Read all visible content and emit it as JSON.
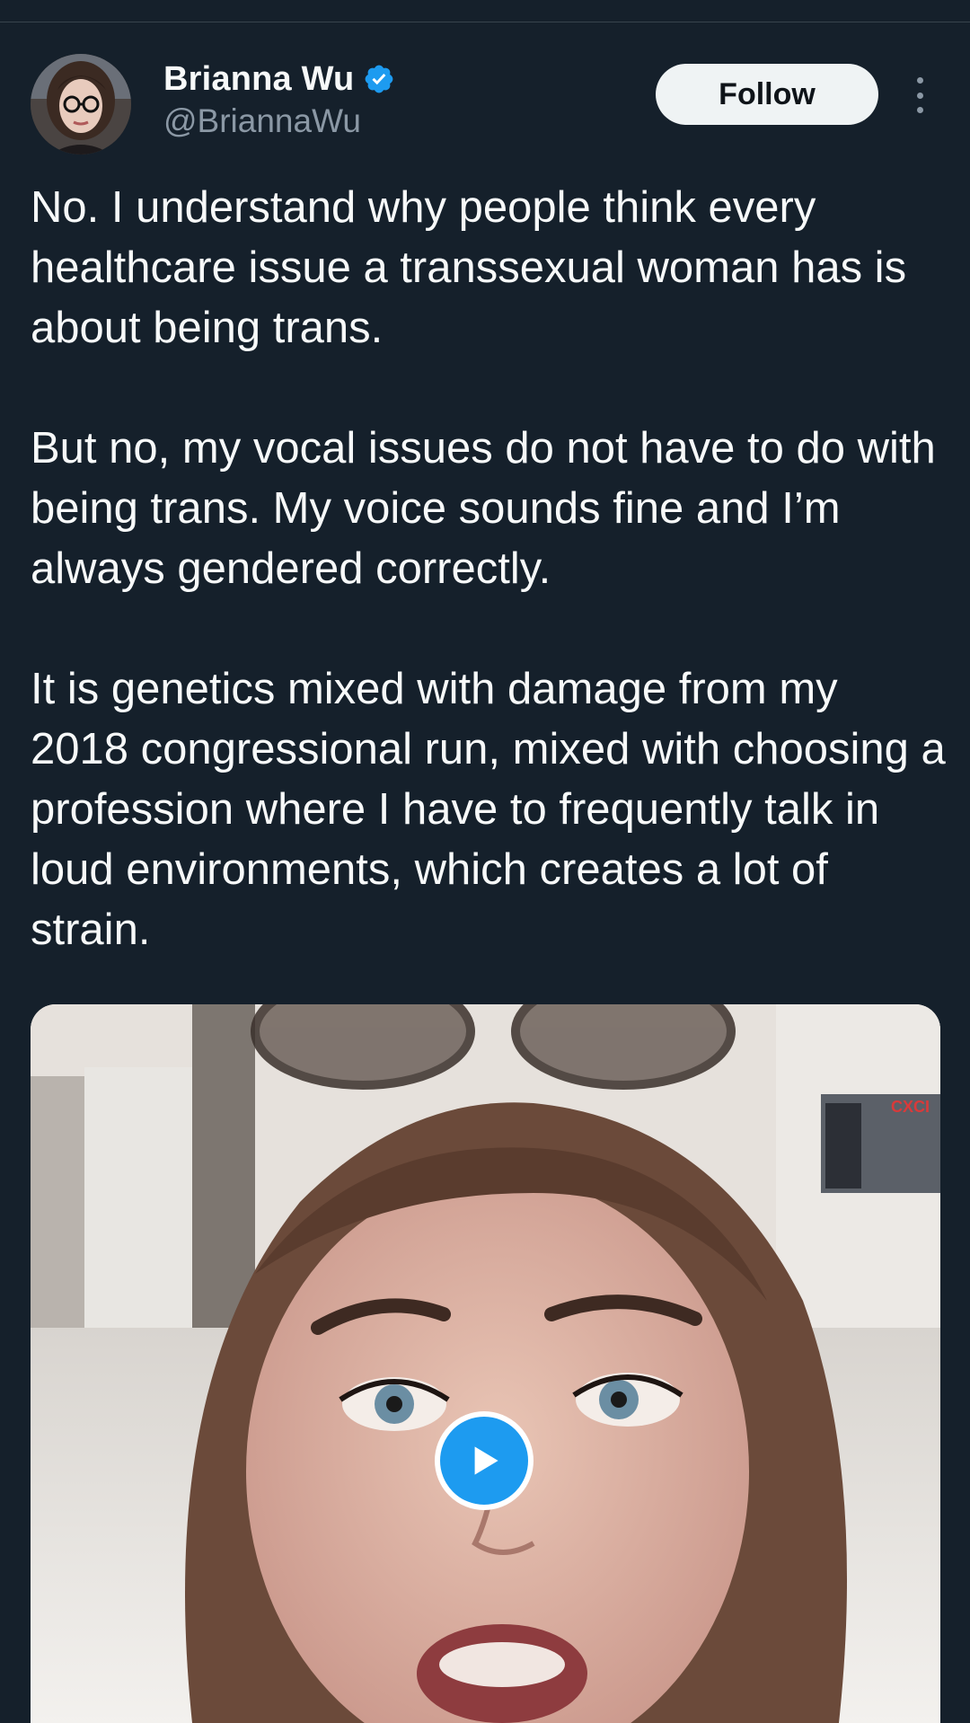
{
  "author": {
    "display_name": "Brianna Wu",
    "handle": "@BriannaWu",
    "verified": true,
    "verified_icon": "verified-badge-icon",
    "verified_color": "#1d9bf0"
  },
  "actions": {
    "follow_label": "Follow",
    "more_icon": "more-options-icon"
  },
  "tweet": {
    "paragraphs": [
      "No. I understand why people think every healthcare issue a transsexual woman has is about being trans.",
      "But no, my vocal issues do not have to do with being trans. My voice sounds fine and I’m always gendered correctly.",
      "It is genetics mixed with damage from my 2018 congressional run, mixed with choosing a profession where I have to frequently talk in loud environments, which creates a lot of strain."
    ]
  },
  "media": {
    "type": "video",
    "play_icon": "play-icon",
    "background_sign_text": "CXCI"
  },
  "colors": {
    "background": "#15202b",
    "text": "#f7f9f9",
    "secondary_text": "#8b98a5",
    "accent": "#1d9bf0",
    "follow_bg": "#eff3f4"
  }
}
